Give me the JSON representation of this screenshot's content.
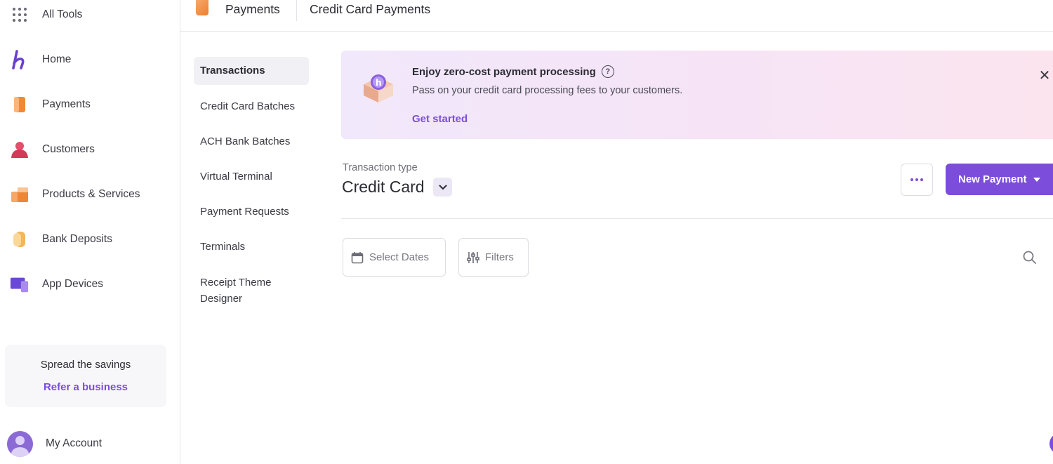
{
  "sidebar": {
    "items": [
      {
        "label": "All Tools",
        "icon": "grid-icon"
      },
      {
        "label": "Home",
        "icon": "home-logo-icon"
      },
      {
        "label": "Payments",
        "icon": "payments-icon"
      },
      {
        "label": "Customers",
        "icon": "customers-icon"
      },
      {
        "label": "Products & Services",
        "icon": "products-icon"
      },
      {
        "label": "Bank Deposits",
        "icon": "bank-deposits-icon"
      },
      {
        "label": "App Devices",
        "icon": "app-devices-icon"
      }
    ],
    "refer": {
      "title": "Spread the savings",
      "link": "Refer a business"
    },
    "account": {
      "label": "My Account"
    }
  },
  "header": {
    "section": "Payments",
    "page": "Credit Card Payments"
  },
  "subnav": {
    "items": [
      {
        "label": "Transactions",
        "active": true
      },
      {
        "label": "Credit Card Batches"
      },
      {
        "label": "ACH Bank Batches"
      },
      {
        "label": "Virtual Terminal"
      },
      {
        "label": "Payment Requests"
      },
      {
        "label": "Terminals"
      },
      {
        "label": "Receipt Theme Designer"
      }
    ]
  },
  "banner": {
    "title": "Enjoy zero-cost payment processing",
    "description": "Pass on your credit card processing fees to your customers.",
    "link": "Get started",
    "help": "?",
    "close": "✕"
  },
  "transaction": {
    "label": "Transaction type",
    "value": "Credit Card"
  },
  "actions": {
    "new_payment": "New Payment"
  },
  "filters": {
    "dates": "Select Dates",
    "filters": "Filters"
  },
  "colors": {
    "accent": "#7c4ddb",
    "banner_start": "#f1e8fb",
    "banner_end": "#fbe4ee"
  }
}
